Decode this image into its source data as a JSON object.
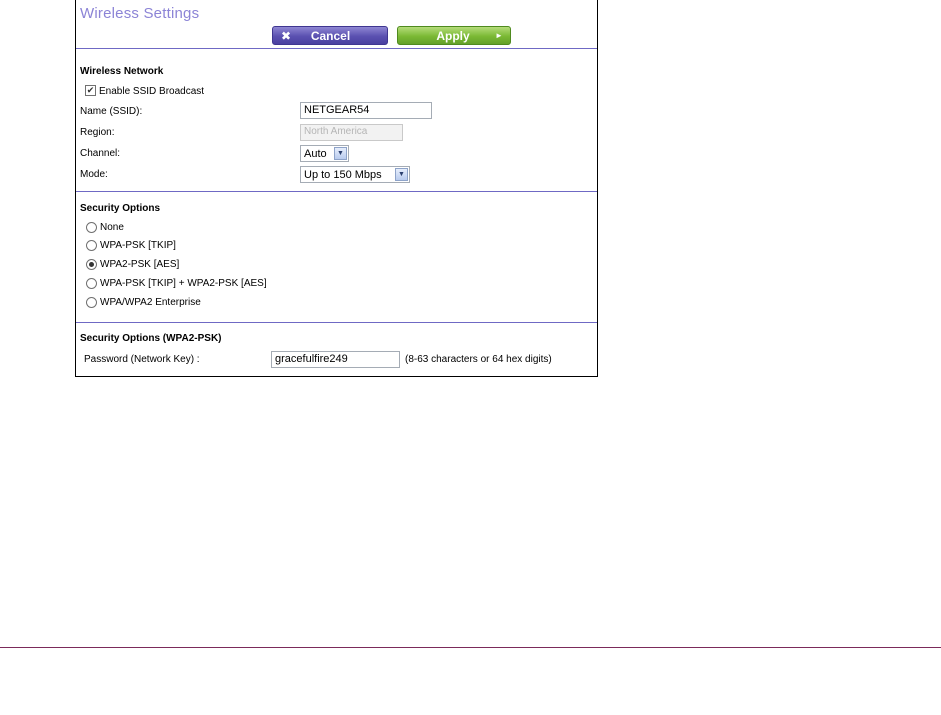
{
  "page": {
    "title": "Wireless Settings",
    "buttons": {
      "cancel_label": "Cancel",
      "cancel_icon": "close-icon",
      "apply_label": "Apply",
      "apply_icon": "arrow-right-icon"
    },
    "colors": {
      "title": "#8c84d6",
      "rule": "#6f69c4",
      "cancel_button": "#5a50b0",
      "apply_button": "#7ab934",
      "footer_rule": "#7b2a5a"
    }
  },
  "wireless_network": {
    "heading": "Wireless Network",
    "enable_ssid": {
      "label": "Enable SSID Broadcast",
      "checked": true
    },
    "name": {
      "label": "Name (SSID):",
      "value": "NETGEAR54"
    },
    "region": {
      "label": "Region:",
      "value": "North America",
      "disabled": true
    },
    "channel": {
      "label": "Channel:",
      "value": "Auto"
    },
    "mode": {
      "label": "Mode:",
      "value": "Up to 150 Mbps"
    }
  },
  "security_options": {
    "heading": "Security Options",
    "options": [
      {
        "label": "None",
        "selected": false
      },
      {
        "label": "WPA-PSK [TKIP]",
        "selected": false
      },
      {
        "label": "WPA2-PSK [AES]",
        "selected": true
      },
      {
        "label": "WPA-PSK [TKIP] + WPA2-PSK [AES]",
        "selected": false
      },
      {
        "label": "WPA/WPA2 Enterprise",
        "selected": false
      }
    ]
  },
  "security_wpa2": {
    "heading": "Security Options (WPA2-PSK)",
    "password": {
      "label": "Password (Network Key) :",
      "value": "gracefulfire249",
      "hint": "(8-63 characters or 64 hex digits)"
    }
  }
}
